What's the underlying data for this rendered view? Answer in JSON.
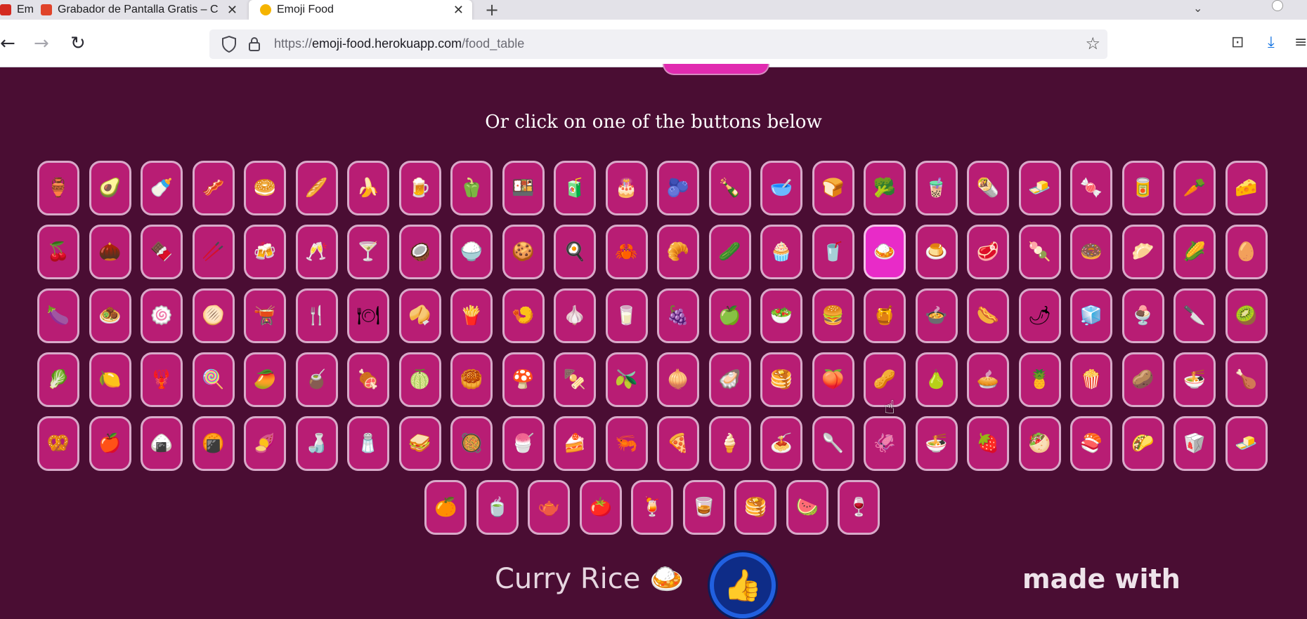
{
  "browser": {
    "tabs": [
      {
        "label": "Emoji Food",
        "favicon_color": "#d42a20"
      },
      {
        "label": "Grabador de Pantalla Gratis – C",
        "favicon_color": "#e0432a"
      },
      {
        "label": "Emoji Food",
        "favicon_color": "#f5b400"
      }
    ],
    "new_tab_icon": "+",
    "tab_list_icon": "⌄",
    "url": {
      "scheme": "https://",
      "host": "emoji-food.herokuapp.com",
      "path": "/food_table"
    },
    "nav": {
      "back_icon": "←",
      "forward_icon": "→",
      "reload_icon": "↻"
    },
    "bookmark_icon": "☆",
    "pocket_icon": "⊡",
    "download_icon": "⤓",
    "menu_icon": "≡"
  },
  "page": {
    "instructions": "Or click on one of the buttons below",
    "active_food": "🍛",
    "foods": [
      [
        "🏺",
        "🥑",
        "🍼",
        "🥓",
        "🥯",
        "🥖",
        "🍌",
        "🍺",
        "🫑",
        "🍱",
        "🧃",
        "🎂",
        "🫐",
        "🍾",
        "🥣",
        "🍞",
        "🥦",
        "🧋",
        "🌯",
        "🧈",
        "🍬",
        "🥫",
        "🥕",
        "🧀"
      ],
      [
        "🍒",
        "🌰",
        "🍫",
        "🥢",
        "🍻",
        "🥂",
        "🍸",
        "🥥",
        "🍚",
        "🍪",
        "🍳",
        "🦀",
        "🥐",
        "🥒",
        "🧁",
        "🥤",
        "🍛",
        "🍮",
        "🥩",
        "🍡",
        "🍩",
        "🥟",
        "🌽",
        "🥚"
      ],
      [
        "🍆",
        "🧆",
        "🍥",
        "🫓",
        "🫕",
        "🍴",
        "🍽",
        "🥠",
        "🍟",
        "🍤",
        "🧄",
        "🥛",
        "🍇",
        "🍏",
        "🥗",
        "🍔",
        "🍯",
        "🍲",
        "🌭",
        "🌶",
        "🧊",
        "🍨",
        "🔪",
        "🥝"
      ],
      [
        "🥬",
        "🍋",
        "🦞",
        "🍭",
        "🥭",
        "🧉",
        "🍖",
        "🍈",
        "🥮",
        "🍄",
        "🍢",
        "🫒",
        "🧅",
        "🦪",
        "🥞",
        "🍑",
        "🥜",
        "🍐",
        "🥧",
        "🍍",
        "🍿",
        "🥔",
        "🍜",
        "🍗"
      ],
      [
        "🥨",
        "🍎",
        "🍙",
        "🍘",
        "🍠",
        "🍶",
        "🧂",
        "🥪",
        "🥘",
        "🍧",
        "🍰",
        "🦐",
        "🍕",
        "🍦",
        "🍝",
        "🥄",
        "🦑",
        "🍜",
        "🍓",
        "🥙",
        "🍣",
        "🌮",
        "🥡",
        "🧈"
      ],
      [
        "🍊",
        "🍵",
        "🫖",
        "🍅",
        "🍹",
        "🥃",
        "🥞",
        "🍉",
        "🍷"
      ]
    ],
    "result": {
      "name": "Curry Rice",
      "emoji": "🍛"
    },
    "like_icon": "👍",
    "footer_text": "made with"
  }
}
